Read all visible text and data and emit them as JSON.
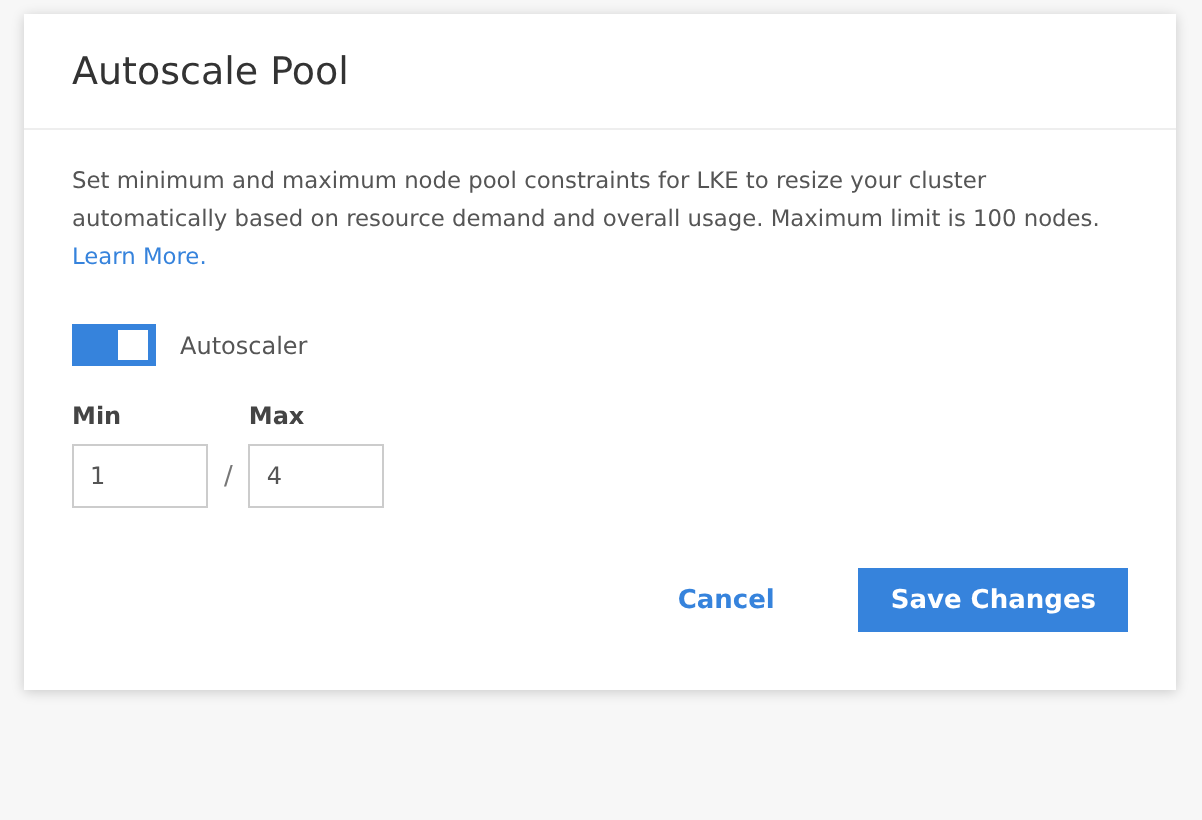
{
  "dialog": {
    "title": "Autoscale Pool",
    "description": "Set minimum and maximum node pool constraints for LKE to resize your cluster automatically based on resource demand and overall usage. Maximum limit is 100 nodes.",
    "link": "Learn More.",
    "toggle": {
      "label": "Autoscaler",
      "on": true
    },
    "min": {
      "label": "Min",
      "value": "1"
    },
    "separator": "/",
    "max": {
      "label": "Max",
      "value": "4"
    },
    "buttons": [
      {
        "label": "Cancel",
        "kind": "secondary"
      },
      {
        "label": "Save Changes",
        "kind": "primary"
      }
    ]
  }
}
